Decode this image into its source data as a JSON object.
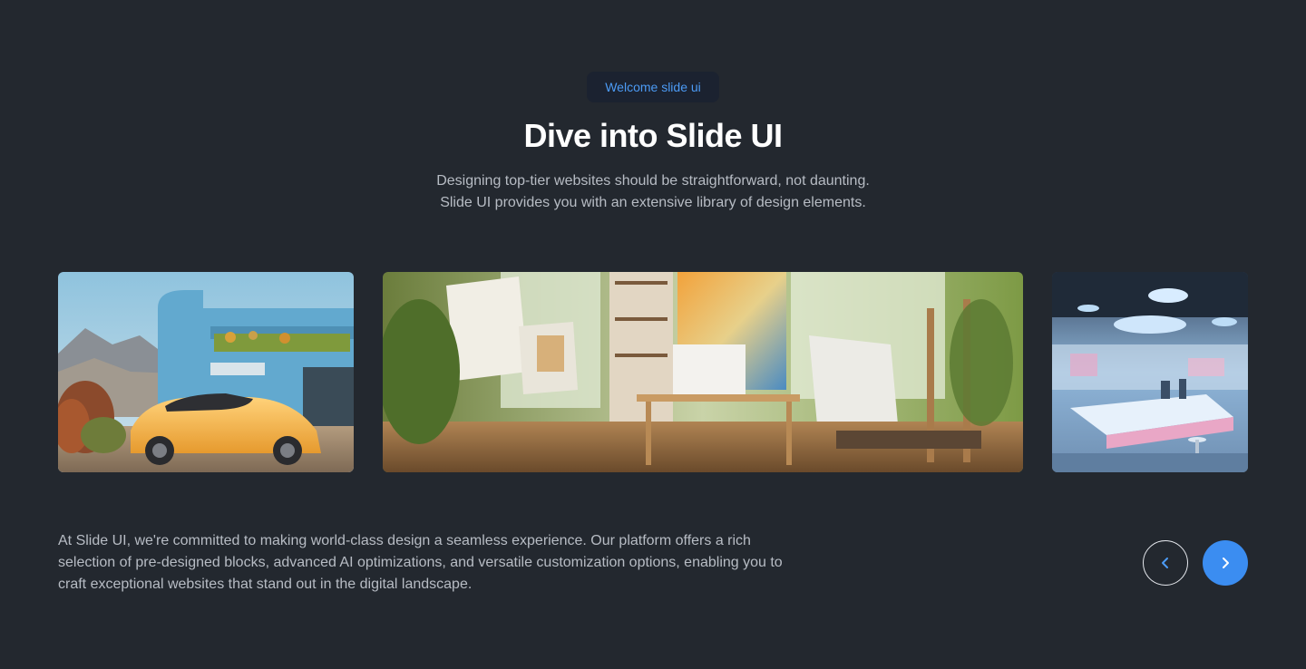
{
  "badge": {
    "label": "Welcome slide ui"
  },
  "hero": {
    "title": "Dive into Slide UI",
    "subtitle_lines": [
      "Designing top-tier websites should be straightforward, not daunting.",
      "Slide UI provides you with an extensive library of design elements."
    ]
  },
  "slides": [
    {
      "name": "car-house"
    },
    {
      "name": "art-studio"
    },
    {
      "name": "lab-interior"
    }
  ],
  "description": "At Slide UI, we're committed to making world-class design a seamless experience. Our platform offers a rich selection of pre-designed blocks, advanced AI optimizations, and versatile customization options, enabling you to craft exceptional websites that stand out in the digital landscape.",
  "nav": {
    "prev_icon": "chevron-left-icon",
    "next_icon": "chevron-right-icon"
  },
  "colors": {
    "background": "#23282f",
    "accent": "#3b8df1",
    "badge_text": "#4c9bf5",
    "muted_text": "#b7bcc4"
  }
}
